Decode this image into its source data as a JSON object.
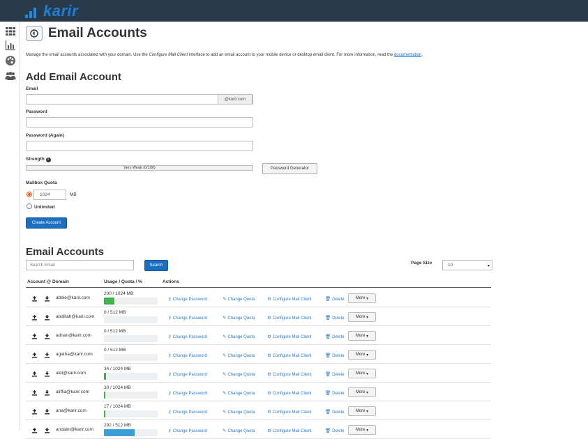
{
  "brand": {
    "name": "karir"
  },
  "sidebar": {
    "items": [
      {
        "icon": "grid-icon"
      },
      {
        "icon": "bar-chart-icon"
      },
      {
        "icon": "palette-icon"
      },
      {
        "icon": "users-icon"
      }
    ]
  },
  "page": {
    "title": "Email Accounts",
    "description_pre": "Manage the email accounts associated with your domain. Use the ",
    "description_em": "Configure Mail Client",
    "description_post": " interface to add an email account to your mobile device or desktop email client. For more information, read the ",
    "description_link": "documentation",
    "description_end": "."
  },
  "add_form": {
    "title": "Add Email Account",
    "email_label": "Email",
    "email_value": "",
    "domain_addon": "@karir.com",
    "password_label": "Password",
    "password_again_label": "Password (Again)",
    "strength_label": "Strength",
    "strength_text": "Very Weak (0/100)",
    "password_generator": "Password Generator",
    "quota_label": "Mailbox Quota",
    "quota_value": "1024",
    "quota_unit": "MB",
    "unlimited_label": "Unlimited",
    "create_button": "Create Account"
  },
  "list": {
    "title": "Email Accounts",
    "search_placeholder": "Search Email",
    "search_button": "Search",
    "page_size_label": "Page Size",
    "page_size_value": "10",
    "columns": [
      "Account @ Domain",
      "Usage / Quota / %",
      "Actions"
    ],
    "action_labels": {
      "change_password": "Change Password",
      "change_quota": "Change Quota",
      "configure": "Configure Mail Client",
      "delete": "Delete",
      "more": "More"
    },
    "rows": [
      {
        "account": "abbie@karir.com",
        "usage": "200 / 1024 MB",
        "percent": 0.195,
        "color": "#3cb44a"
      },
      {
        "account": "abdillah@karir.com",
        "usage": "0 / 512 MB",
        "percent": 0,
        "color": "#3cb44a"
      },
      {
        "account": "adnan@karir.com",
        "usage": "0 / 512 MB",
        "percent": 0,
        "color": "#3cb44a"
      },
      {
        "account": "agatha@karir.com",
        "usage": "0 / 512 MB",
        "percent": 0,
        "color": "#3cb44a"
      },
      {
        "account": "aldi@karir.com",
        "usage": "34 / 1024 MB",
        "percent": 0.033,
        "color": "#3cb44a"
      },
      {
        "account": "aliffia@karir.com",
        "usage": "30 / 1024 MB",
        "percent": 0.029,
        "color": "#3cb44a"
      },
      {
        "account": "ana@karir.com",
        "usage": "17 / 1024 MB",
        "percent": 0.017,
        "color": "#3cb44a"
      },
      {
        "account": "andaini@karir.com",
        "usage": "292 / 512 MB",
        "percent": 0.57,
        "color": "#3a9fd8"
      }
    ]
  }
}
